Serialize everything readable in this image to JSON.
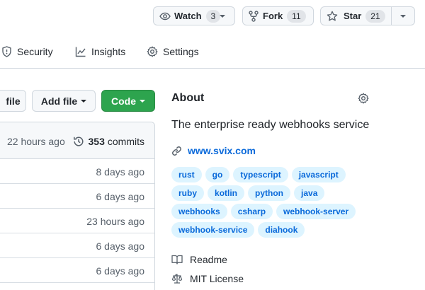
{
  "header": {
    "watch": {
      "label": "Watch",
      "count": "3"
    },
    "fork": {
      "label": "Fork",
      "count": "11"
    },
    "star": {
      "label": "Star",
      "count": "21"
    }
  },
  "tabs": [
    {
      "label": "Security",
      "icon": "shield-icon"
    },
    {
      "label": "Insights",
      "icon": "graph-icon"
    },
    {
      "label": "Settings",
      "icon": "gear-icon"
    }
  ],
  "toolbar": {
    "file_label": "file",
    "add_file_label": "Add file",
    "code_label": "Code",
    "code_color": "#2da44e"
  },
  "commits": {
    "last_updated": "22 hours ago",
    "count": "353",
    "label": "commits"
  },
  "files": [
    {
      "age": "8 days ago"
    },
    {
      "age": "6 days ago"
    },
    {
      "age": "23 hours ago"
    },
    {
      "age": "6 days ago"
    },
    {
      "age": "6 days ago"
    }
  ],
  "about": {
    "title": "About",
    "description": "The enterprise ready webhooks service",
    "website": "www.svix.com",
    "topics": [
      [
        "rust",
        "go",
        "typescript",
        "javascript"
      ],
      [
        "ruby",
        "kotlin",
        "python",
        "java"
      ],
      [
        "webhooks",
        "csharp",
        "webhook-server"
      ],
      [
        "webhook-service",
        "diahook"
      ]
    ],
    "readme": "Readme",
    "license": "MIT License",
    "link_color": "#0969da",
    "topic_bg": "#ddf4ff"
  }
}
